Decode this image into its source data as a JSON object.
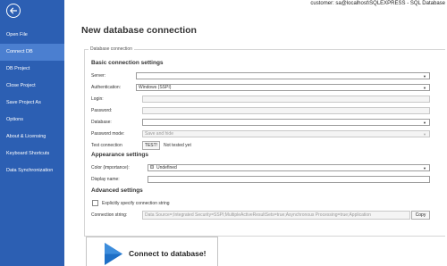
{
  "window": {
    "status_line": "customer: sa@localhost\\SQLEXPRESS - SQL Database"
  },
  "colors": {
    "sidebar_bg": "#2c5fb3",
    "sidebar_active": "#4b7fd0",
    "connect_icon": "#1e6fc6"
  },
  "sidebar": {
    "back_icon": "arrow-left-icon",
    "items": [
      {
        "label": "Open File",
        "active": false
      },
      {
        "label": "Connect DB",
        "active": true
      },
      {
        "label": "DB Project",
        "active": false
      },
      {
        "label": "Close Project",
        "active": false
      },
      {
        "label": "Save Project As",
        "active": false
      },
      {
        "label": "Options",
        "active": false
      },
      {
        "label": "About & Licensing",
        "active": false
      },
      {
        "label": "Keyboard Shortcuts",
        "active": false
      },
      {
        "label": "Data Synchronization",
        "active": false
      }
    ]
  },
  "main": {
    "title": "New database connection",
    "group_legend": "Database connection",
    "basic": {
      "heading": "Basic connection settings",
      "server_label": "Server:",
      "server_value": "",
      "authentication_label": "Authentication:",
      "authentication_value": "Windows (SSPI)",
      "login_label": "Login:",
      "login_value": "",
      "password_label": "Password:",
      "password_value": "",
      "database_label": "Database:",
      "database_value": "",
      "password_mode_label": "Password mode:",
      "password_mode_value": "Save and hide",
      "test_label": "Test connection",
      "test_button": "TEST!",
      "test_status": "Not tested yet"
    },
    "appearance": {
      "heading": "Appearance settings",
      "color_label": "Color (importance):",
      "color_value": "Undefined",
      "display_name_label": "Display name:",
      "display_name_value": ""
    },
    "advanced": {
      "heading": "Advanced settings",
      "explicit_label": "Explicitly specify connection string",
      "explicit_checked": false,
      "connection_string_label": "Connection string:",
      "connection_string_value": "Data Source=;Integrated Security=SSPI;MultipleActiveResultSets=true;Asynchronous Processing=true;Application",
      "copy_button": "Copy"
    },
    "connect_button": "Connect to database!"
  }
}
